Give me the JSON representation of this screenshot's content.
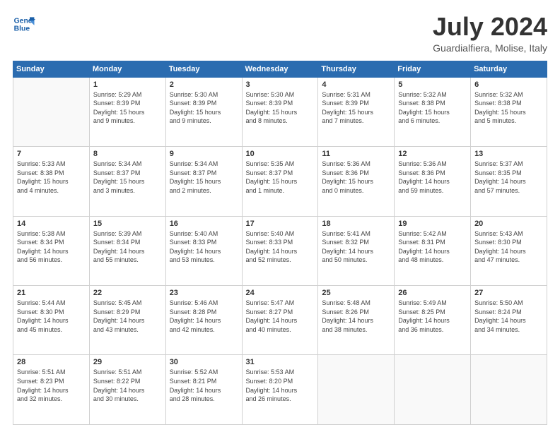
{
  "logo": {
    "line1": "General",
    "line2": "Blue"
  },
  "title": "July 2024",
  "location": "Guardialfiera, Molise, Italy",
  "days_header": [
    "Sunday",
    "Monday",
    "Tuesday",
    "Wednesday",
    "Thursday",
    "Friday",
    "Saturday"
  ],
  "weeks": [
    [
      {
        "num": "",
        "info": ""
      },
      {
        "num": "1",
        "info": "Sunrise: 5:29 AM\nSunset: 8:39 PM\nDaylight: 15 hours\nand 9 minutes."
      },
      {
        "num": "2",
        "info": "Sunrise: 5:30 AM\nSunset: 8:39 PM\nDaylight: 15 hours\nand 9 minutes."
      },
      {
        "num": "3",
        "info": "Sunrise: 5:30 AM\nSunset: 8:39 PM\nDaylight: 15 hours\nand 8 minutes."
      },
      {
        "num": "4",
        "info": "Sunrise: 5:31 AM\nSunset: 8:39 PM\nDaylight: 15 hours\nand 7 minutes."
      },
      {
        "num": "5",
        "info": "Sunrise: 5:32 AM\nSunset: 8:38 PM\nDaylight: 15 hours\nand 6 minutes."
      },
      {
        "num": "6",
        "info": "Sunrise: 5:32 AM\nSunset: 8:38 PM\nDaylight: 15 hours\nand 5 minutes."
      }
    ],
    [
      {
        "num": "7",
        "info": "Sunrise: 5:33 AM\nSunset: 8:38 PM\nDaylight: 15 hours\nand 4 minutes."
      },
      {
        "num": "8",
        "info": "Sunrise: 5:34 AM\nSunset: 8:37 PM\nDaylight: 15 hours\nand 3 minutes."
      },
      {
        "num": "9",
        "info": "Sunrise: 5:34 AM\nSunset: 8:37 PM\nDaylight: 15 hours\nand 2 minutes."
      },
      {
        "num": "10",
        "info": "Sunrise: 5:35 AM\nSunset: 8:37 PM\nDaylight: 15 hours\nand 1 minute."
      },
      {
        "num": "11",
        "info": "Sunrise: 5:36 AM\nSunset: 8:36 PM\nDaylight: 15 hours\nand 0 minutes."
      },
      {
        "num": "12",
        "info": "Sunrise: 5:36 AM\nSunset: 8:36 PM\nDaylight: 14 hours\nand 59 minutes."
      },
      {
        "num": "13",
        "info": "Sunrise: 5:37 AM\nSunset: 8:35 PM\nDaylight: 14 hours\nand 57 minutes."
      }
    ],
    [
      {
        "num": "14",
        "info": "Sunrise: 5:38 AM\nSunset: 8:34 PM\nDaylight: 14 hours\nand 56 minutes."
      },
      {
        "num": "15",
        "info": "Sunrise: 5:39 AM\nSunset: 8:34 PM\nDaylight: 14 hours\nand 55 minutes."
      },
      {
        "num": "16",
        "info": "Sunrise: 5:40 AM\nSunset: 8:33 PM\nDaylight: 14 hours\nand 53 minutes."
      },
      {
        "num": "17",
        "info": "Sunrise: 5:40 AM\nSunset: 8:33 PM\nDaylight: 14 hours\nand 52 minutes."
      },
      {
        "num": "18",
        "info": "Sunrise: 5:41 AM\nSunset: 8:32 PM\nDaylight: 14 hours\nand 50 minutes."
      },
      {
        "num": "19",
        "info": "Sunrise: 5:42 AM\nSunset: 8:31 PM\nDaylight: 14 hours\nand 48 minutes."
      },
      {
        "num": "20",
        "info": "Sunrise: 5:43 AM\nSunset: 8:30 PM\nDaylight: 14 hours\nand 47 minutes."
      }
    ],
    [
      {
        "num": "21",
        "info": "Sunrise: 5:44 AM\nSunset: 8:30 PM\nDaylight: 14 hours\nand 45 minutes."
      },
      {
        "num": "22",
        "info": "Sunrise: 5:45 AM\nSunset: 8:29 PM\nDaylight: 14 hours\nand 43 minutes."
      },
      {
        "num": "23",
        "info": "Sunrise: 5:46 AM\nSunset: 8:28 PM\nDaylight: 14 hours\nand 42 minutes."
      },
      {
        "num": "24",
        "info": "Sunrise: 5:47 AM\nSunset: 8:27 PM\nDaylight: 14 hours\nand 40 minutes."
      },
      {
        "num": "25",
        "info": "Sunrise: 5:48 AM\nSunset: 8:26 PM\nDaylight: 14 hours\nand 38 minutes."
      },
      {
        "num": "26",
        "info": "Sunrise: 5:49 AM\nSunset: 8:25 PM\nDaylight: 14 hours\nand 36 minutes."
      },
      {
        "num": "27",
        "info": "Sunrise: 5:50 AM\nSunset: 8:24 PM\nDaylight: 14 hours\nand 34 minutes."
      }
    ],
    [
      {
        "num": "28",
        "info": "Sunrise: 5:51 AM\nSunset: 8:23 PM\nDaylight: 14 hours\nand 32 minutes."
      },
      {
        "num": "29",
        "info": "Sunrise: 5:51 AM\nSunset: 8:22 PM\nDaylight: 14 hours\nand 30 minutes."
      },
      {
        "num": "30",
        "info": "Sunrise: 5:52 AM\nSunset: 8:21 PM\nDaylight: 14 hours\nand 28 minutes."
      },
      {
        "num": "31",
        "info": "Sunrise: 5:53 AM\nSunset: 8:20 PM\nDaylight: 14 hours\nand 26 minutes."
      },
      {
        "num": "",
        "info": ""
      },
      {
        "num": "",
        "info": ""
      },
      {
        "num": "",
        "info": ""
      }
    ]
  ]
}
